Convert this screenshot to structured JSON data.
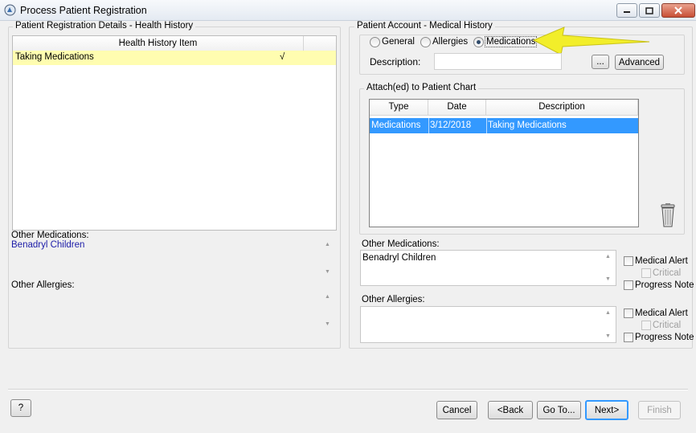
{
  "window": {
    "title": "Process Patient Registration"
  },
  "left_panel": {
    "group_title": "Patient Registration Details - Health History",
    "table": {
      "header": "Health History Item",
      "rows": [
        {
          "item": "Taking Medications",
          "check": "√"
        }
      ]
    },
    "other_medications": {
      "label": "Other Medications:",
      "value": "Benadryl Children"
    },
    "other_allergies": {
      "label": "Other Allergies:",
      "value": ""
    }
  },
  "right_panel": {
    "group_title": "Patient Account - Medical History",
    "radios": [
      {
        "label": "General",
        "checked": false
      },
      {
        "label": "Allergies",
        "checked": false
      },
      {
        "label": "Medications",
        "checked": true
      }
    ],
    "description": {
      "label": "Description:",
      "value": ""
    },
    "ellipsis_label": "...",
    "advanced_label": "Advanced",
    "chart": {
      "group_title": "Attach(ed) to Patient Chart",
      "columns": {
        "type": "Type",
        "date": "Date",
        "description": "Description"
      },
      "rows": [
        {
          "type": "Medications",
          "date": "3/12/2018",
          "description": "Taking Medications"
        }
      ]
    },
    "other_medications": {
      "label": "Other Medications:",
      "value": "Benadryl Children",
      "medical_alert": "Medical Alert",
      "critical": "Critical",
      "progress_note": "Progress Note"
    },
    "other_allergies": {
      "label": "Other Allergies:",
      "value": "",
      "medical_alert": "Medical Alert",
      "critical": "Critical",
      "progress_note": "Progress Note"
    }
  },
  "footer": {
    "help": "?",
    "cancel": "Cancel",
    "back": "<Back",
    "goto": "Go To...",
    "next": "Next>",
    "finish": "Finish"
  },
  "colors": {
    "selected_row": "#fffdb0",
    "chart_selected": "#3399ff",
    "link_blue": "#1c1ca8",
    "arrow_yellow": "#f2ee2a"
  },
  "icons": [
    "app-icon",
    "minimize-icon",
    "maximize-icon",
    "close-icon",
    "trash-icon",
    "arrow-annotation"
  ]
}
